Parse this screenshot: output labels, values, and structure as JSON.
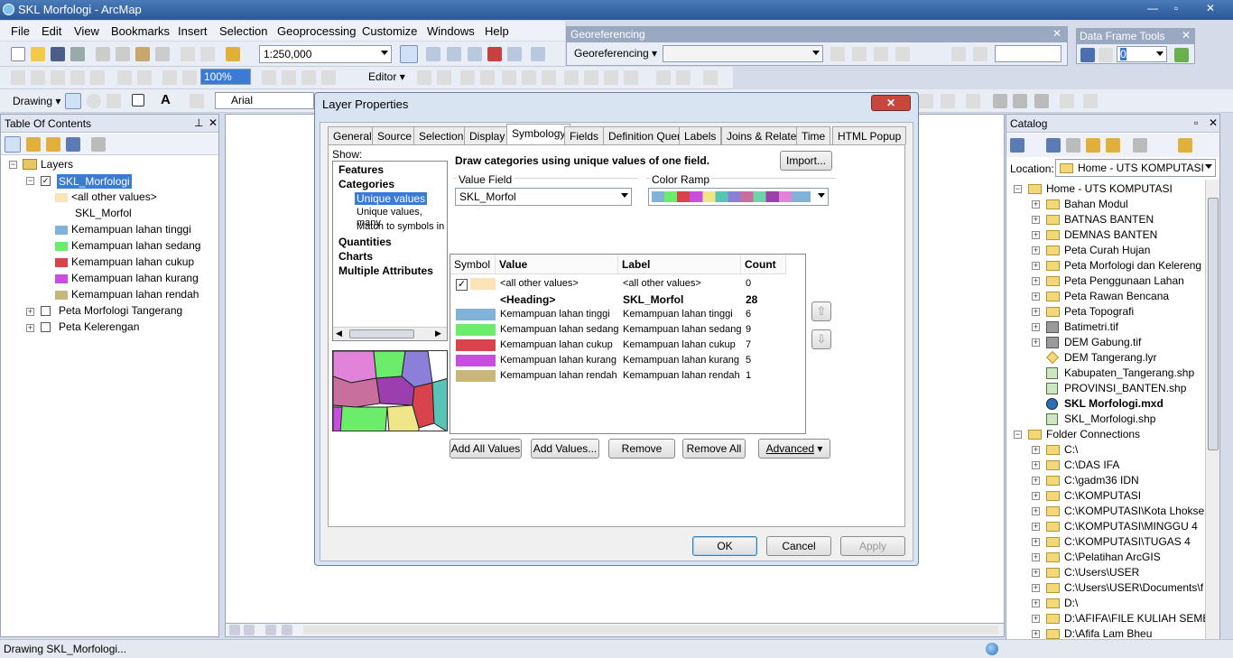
{
  "window": {
    "title": "SKL Morfologi - ArcMap"
  },
  "menu": [
    "File",
    "Edit",
    "View",
    "Bookmarks",
    "Insert",
    "Selection",
    "Geoprocessing",
    "Customize",
    "Windows",
    "Help"
  ],
  "toolbar": {
    "scale": "1:250,000",
    "editor": "Editor",
    "drawing": "Drawing",
    "font": "Arial",
    "zoom": "100%"
  },
  "georef": {
    "title": "Georeferencing",
    "menu": "Georeferencing"
  },
  "dataframe": {
    "title": "Data Frame Tools",
    "value": "0"
  },
  "toc": {
    "title": "Table Of Contents",
    "layers_label": "Layers",
    "layer_name": "SKL_Morfologi",
    "all_other": "<all other values>",
    "field": "SKL_Morfol",
    "classes": [
      {
        "label": "Kemampuan lahan tinggi",
        "color": "#7fb3d9"
      },
      {
        "label": "Kemampuan lahan sedang",
        "color": "#6bec6b"
      },
      {
        "label": "Kemampuan lahan cukup",
        "color": "#d9444c"
      },
      {
        "label": "Kemampuan lahan kurang",
        "color": "#c84de0"
      },
      {
        "label": "Kemampuan lahan rendah",
        "color": "#c9b67a"
      }
    ],
    "other_layers": [
      "Peta Morfologi Tangerang",
      "Peta Kelerengan"
    ]
  },
  "dialog": {
    "title": "Layer Properties",
    "tabs": [
      "General",
      "Source",
      "Selection",
      "Display",
      "Symbology",
      "Fields",
      "Definition Query",
      "Labels",
      "Joins & Relates",
      "Time",
      "HTML Popup"
    ],
    "show_label": "Show:",
    "show_items": [
      "Features",
      "Categories",
      "Unique values",
      "Unique values, many",
      "Match to symbols in a",
      "Quantities",
      "Charts",
      "Multiple Attributes"
    ],
    "heading": "Draw categories using unique values of one field.",
    "import_label": "Import...",
    "value_field_label": "Value Field",
    "value_field": "SKL_Morfol",
    "color_ramp_label": "Color Ramp",
    "columns": [
      "Symbol",
      "Value",
      "Label",
      "Count"
    ],
    "rows": [
      {
        "value": "<all other values>",
        "label": "<all other values>",
        "count": "0",
        "color": "#fde3b5"
      },
      {
        "value": "<Heading>",
        "label": "SKL_Morfol",
        "count": "28",
        "color": ""
      },
      {
        "value": "Kemampuan lahan tinggi",
        "label": "Kemampuan lahan tinggi",
        "count": "6",
        "color": "#7fb3d9"
      },
      {
        "value": "Kemampuan lahan sedang",
        "label": "Kemampuan lahan sedang",
        "count": "9",
        "color": "#6bec6b"
      },
      {
        "value": "Kemampuan lahan cukup",
        "label": "Kemampuan lahan cukup",
        "count": "7",
        "color": "#d9444c"
      },
      {
        "value": "Kemampuan lahan kurang",
        "label": "Kemampuan lahan kurang",
        "count": "5",
        "color": "#c84de0"
      },
      {
        "value": "Kemampuan lahan rendah",
        "label": "Kemampuan lahan rendah",
        "count": "1",
        "color": "#c9b67a"
      }
    ],
    "buttons": {
      "add_all": "Add All Values",
      "add": "Add Values...",
      "remove": "Remove",
      "remove_all": "Remove All",
      "advanced": "Advanced",
      "ok": "OK",
      "cancel": "Cancel",
      "apply": "Apply"
    }
  },
  "catalog": {
    "title": "Catalog",
    "location_label": "Location:",
    "location": "Home - UTS KOMPUTASI",
    "root": "Home - UTS KOMPUTASI",
    "items": [
      "Bahan Modul",
      "BATNAS BANTEN",
      "DEMNAS BANTEN",
      "Peta Curah Hujan",
      "Peta Morfologi dan Kelereng",
      "Peta Penggunaan Lahan",
      "Peta Rawan Bencana",
      "Peta Topografi",
      "Batimetri.tif",
      "DEM Gabung.tif",
      "DEM Tangerang.lyr",
      "Kabupaten_Tangerang.shp",
      "PROVINSI_BANTEN.shp",
      "SKL Morfologi.mxd",
      "SKL_Morfologi.shp"
    ],
    "folder_connections": "Folder Connections",
    "connections": [
      "C:\\",
      "C:\\DAS IFA",
      "C:\\gadm36 IDN",
      "C:\\KOMPUTASI",
      "C:\\KOMPUTASI\\Kota Lhokse",
      "C:\\KOMPUTASI\\MINGGU 4",
      "C:\\KOMPUTASI\\TUGAS 4",
      "C:\\Pelatihan ArcGIS",
      "C:\\Users\\USER",
      "C:\\Users\\USER\\Documents\\f",
      "D:\\",
      "D:\\AFIFA\\FILE KULIAH SEME",
      "D:\\Afifa Lam Bheu"
    ]
  },
  "status": {
    "text": "Drawing SKL_Morfologi..."
  }
}
